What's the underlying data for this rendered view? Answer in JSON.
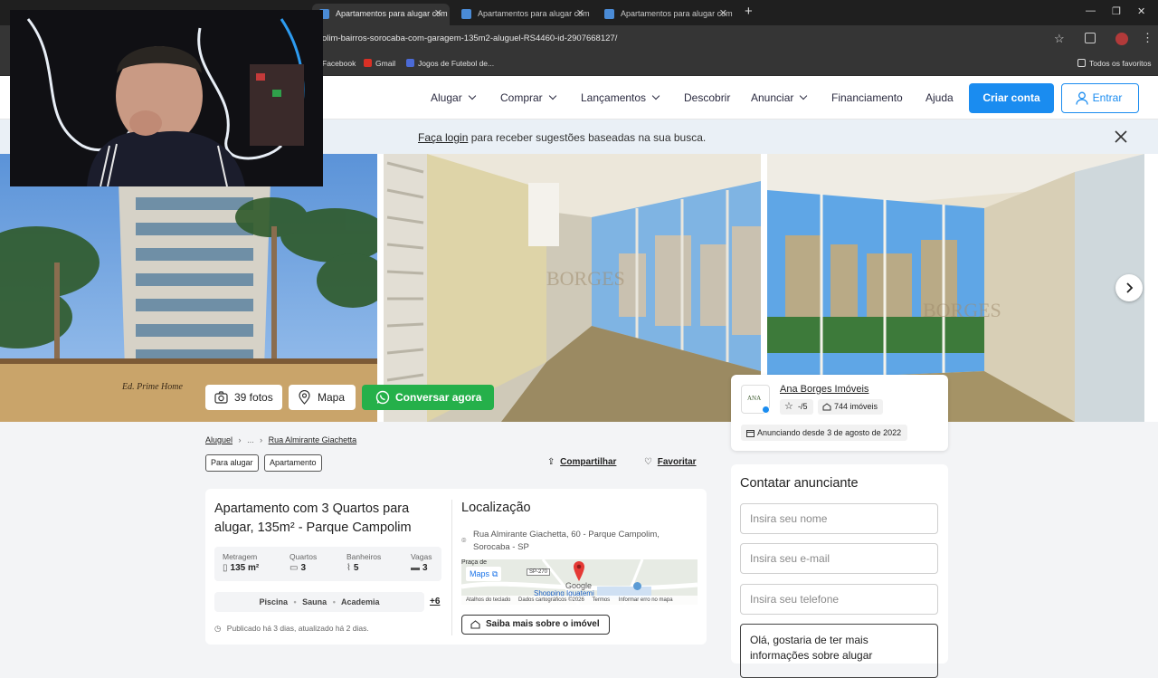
{
  "browser": {
    "tabs": [
      {
        "title": "Apartamentos para alugar com"
      },
      {
        "title": "Apartamentos para alugar com"
      },
      {
        "title": "Apartamentos para alugar com"
      }
    ],
    "new_tab_symbol": "+",
    "url": "olim-bairros-sorocaba-com-garagem-135m2-aluguel-RS4460-id-2907668127/",
    "bookmarks": [
      {
        "label": "Facebook",
        "icon": "facebook-icon"
      },
      {
        "label": "Gmail",
        "icon": "gmail-icon"
      },
      {
        "label": "Jogos de Futebol de...",
        "icon": "bookmark-icon"
      }
    ],
    "all_bookmarks": "Todos os favoritos"
  },
  "header": {
    "nav": [
      {
        "label": "Alugar",
        "dropdown": true
      },
      {
        "label": "Comprar",
        "dropdown": true
      },
      {
        "label": "Lançamentos",
        "dropdown": true
      },
      {
        "label": "Descobrir",
        "dropdown": false
      },
      {
        "label": "Anunciar",
        "dropdown": true
      },
      {
        "label": "Financiamento",
        "dropdown": false
      },
      {
        "label": "Ajuda",
        "dropdown": false
      }
    ],
    "create_account": "Criar conta",
    "login": "Entrar"
  },
  "banner": {
    "link": "Faça login",
    "text": " para receber sugestões baseadas na sua busca."
  },
  "gallery": {
    "photos_label": "39 fotos",
    "map_label": "Mapa",
    "whatsapp_label": "Conversar agora",
    "watermark": "BORGES",
    "building_sign": "Ed. Prime Home"
  },
  "agent": {
    "name": "Ana Borges Imóveis",
    "rating": "-/5",
    "listings": "744 imóveis",
    "since": "Anunciando desde 3 de agosto de 2022",
    "logo_text": "ANA"
  },
  "breadcrumb": {
    "root": "Aluguel",
    "ellipsis": "...",
    "street": "Rua Almirante Giachetta"
  },
  "tags": [
    "Para alugar",
    "Apartamento"
  ],
  "actions": {
    "share": "Compartilhar",
    "favorite": "Favoritar"
  },
  "listing": {
    "title_line1": "Apartamento com 3 Quartos para",
    "title_line2": "alugar, 135m² - Parque Campolim",
    "specs": [
      {
        "label": "Metragem",
        "value": "135 m²",
        "icon": "ruler-icon"
      },
      {
        "label": "Quartos",
        "value": "3",
        "icon": "bed-icon"
      },
      {
        "label": "Banheiros",
        "value": "5",
        "icon": "shower-icon"
      },
      {
        "label": "Vagas",
        "value": "3",
        "icon": "car-icon"
      }
    ],
    "amenities": [
      "Piscina",
      "Sauna",
      "Academia"
    ],
    "more_amenities": "+6",
    "published": "Publicado há 3 dias, atualizado há 2 dias."
  },
  "location": {
    "title": "Localização",
    "address_line1": "Rua Almirante Giachetta, 60 - Parque Campolim,",
    "address_line2": "Sorocaba - SP",
    "maps_link": "Maps",
    "map_road": "SP-270",
    "map_place": "Shopping Iguatemi",
    "map_brand": "Google",
    "map_label_left": "Praça de",
    "map_footer": [
      "Atalhos do teclado",
      "Dados cartográficos ©2026",
      "Termos",
      "Informar erro no mapa"
    ],
    "more_button": "Saiba mais sobre o imóvel"
  },
  "contact": {
    "title": "Contatar anunciante",
    "name_placeholder": "Insira seu nome",
    "email_placeholder": "Insira seu e-mail",
    "phone_placeholder": "Insira seu telefone",
    "message": "Olá, gostaria de ter mais informações sobre alugar"
  },
  "colors": {
    "primary": "#1a8cf0",
    "whatsapp": "#25b04a",
    "pin": "#e53935"
  }
}
